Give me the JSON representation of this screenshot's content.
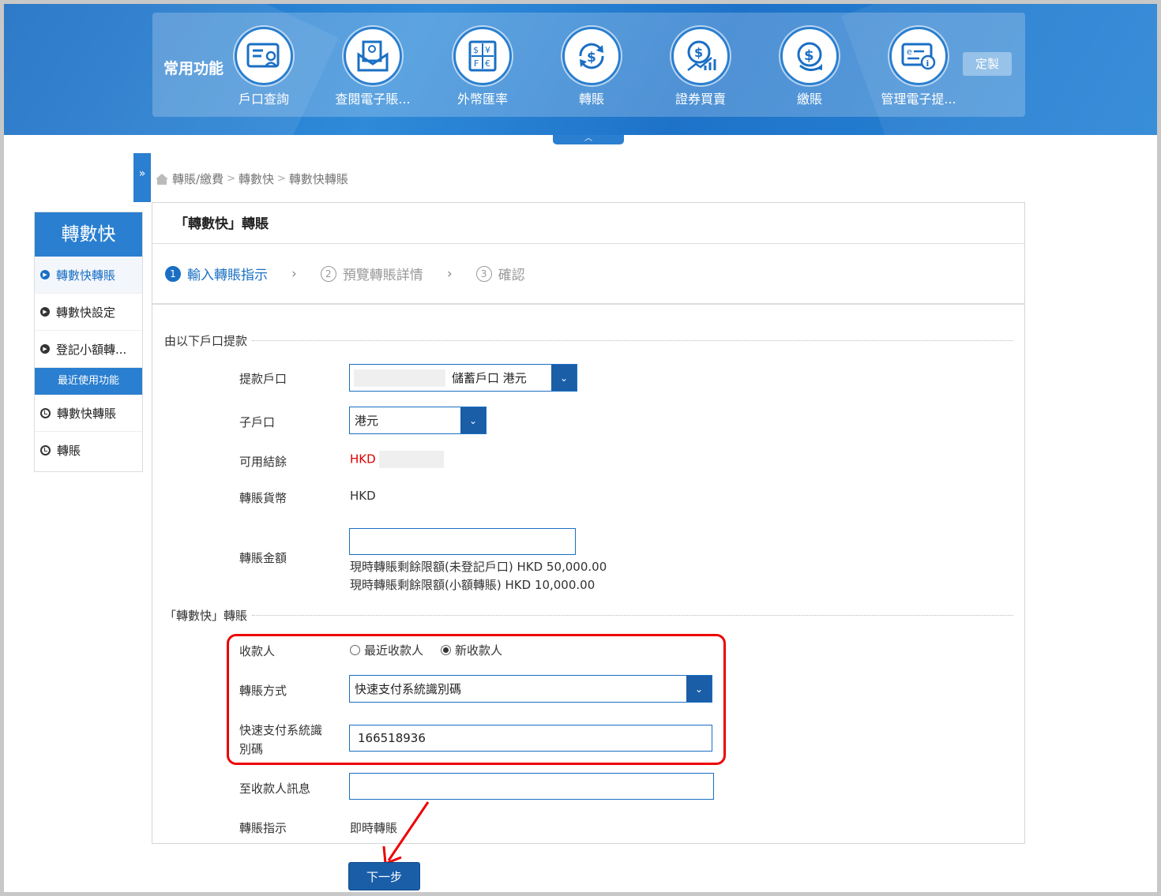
{
  "quickbar": {
    "title": "常用功能",
    "customize_label": "定製",
    "items": [
      {
        "label": "戶口查詢",
        "icon": "account-card-icon"
      },
      {
        "label": "查閱電子賬...",
        "icon": "e-statement-icon"
      },
      {
        "label": "外幣匯率",
        "icon": "currency-exchange-icon"
      },
      {
        "label": "轉賬",
        "icon": "transfer-icon"
      },
      {
        "label": "證券買賣",
        "icon": "securities-icon"
      },
      {
        "label": "繳賬",
        "icon": "bill-payment-icon"
      },
      {
        "label": "管理電子提...",
        "icon": "e-alert-icon"
      }
    ]
  },
  "breadcrumb": {
    "items": [
      "轉賬/繳費",
      "轉數快",
      "轉數快轉賬"
    ]
  },
  "sidenav": {
    "title": "轉數快",
    "items": [
      {
        "label": "轉數快轉賬"
      },
      {
        "label": "轉數快設定"
      },
      {
        "label": "登記小額轉..."
      }
    ],
    "recent_title": "最近使用功能",
    "recent": [
      {
        "label": "轉數快轉賬"
      },
      {
        "label": "轉賬"
      }
    ]
  },
  "panel": {
    "title": "「轉數快」轉賬",
    "steps": [
      {
        "num": "1",
        "label": "輸入轉賬指示"
      },
      {
        "num": "2",
        "label": "預覽轉賬詳情"
      },
      {
        "num": "3",
        "label": "確認"
      }
    ]
  },
  "from_section": {
    "title": "由以下戶口提款",
    "account_label": "提款戶口",
    "account_value": "儲蓄戶口  港元",
    "subaccount_label": "子戶口",
    "subaccount_value": "港元",
    "balance_label": "可用結餘",
    "balance_currency": "HKD",
    "currency_label": "轉賬貨幣",
    "currency_value": "HKD",
    "amount_label": "轉賬金額",
    "amount_value": "",
    "limit_unregistered": "現時轉賬剩餘限額(未登記戶口) HKD 50,000.00",
    "limit_small": "現時轉賬剩餘限額(小額轉賬) HKD 10,000.00"
  },
  "fps_section": {
    "title": "「轉數快」轉賬",
    "payee_label": "收款人",
    "payee_options": [
      "最近收款人",
      "新收款人"
    ],
    "method_label": "轉賬方式",
    "method_value": "快速支付系統識別碼",
    "fps_id_label": "快速支付系統識\n別碼",
    "fps_id_value": "166518936",
    "message_label": "至收款人訊息",
    "message_value": "",
    "instruction_label": "轉賬指示",
    "instruction_value": "即時轉賬"
  },
  "next_label": "下一步",
  "colors": {
    "primary": "#1a6fc4",
    "accent_red": "#e00000"
  }
}
